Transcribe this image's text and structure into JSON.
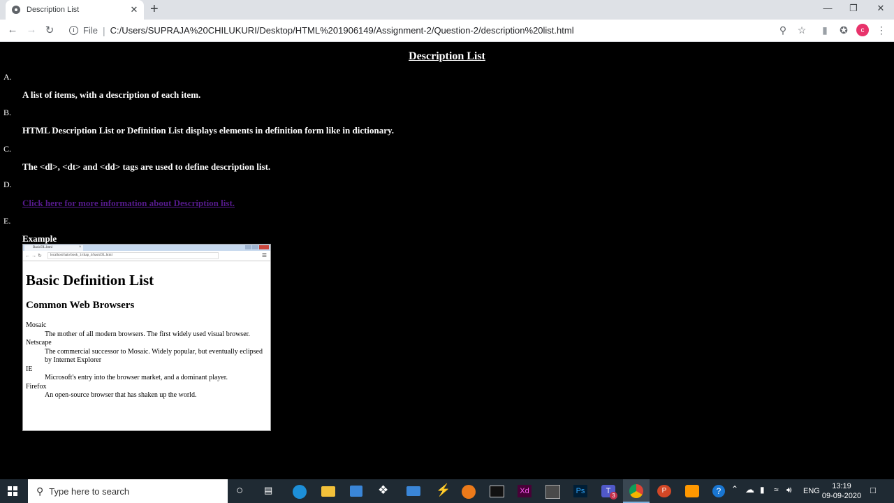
{
  "browser": {
    "tab_title": "Description List",
    "tab_close": "✕",
    "new_tab": "+",
    "scheme": "File",
    "separator": "|",
    "url": "C:/Users/SUPRAJA%20CHILUKURI/Desktop/HTML%201906149/Assignment-2/Question-2/description%20list.html",
    "profile_initial": "c",
    "icons": [
      "back-icon",
      "forward-icon",
      "reload-icon",
      "info-icon",
      "zoom-icon",
      "star-icon",
      "extension-icon",
      "puzzle-icon",
      "menu-icon"
    ]
  },
  "page": {
    "title": "Description List",
    "items": [
      {
        "term": "A.",
        "desc": "A list of items, with a description of each item."
      },
      {
        "term": "B.",
        "desc": "HTML Description List or Definition List displays elements in definition form like in dictionary."
      },
      {
        "term": "C.",
        "desc": "The <dl>, <dt> and <dd> tags are used to define description list."
      },
      {
        "term": "D.",
        "desc": "Click here for more information about Description list."
      },
      {
        "term": "E.",
        "desc": "Example"
      }
    ],
    "colors": {
      "background": "#000000",
      "text": "#ffffff",
      "link": "#551a8b"
    }
  },
  "example": {
    "tab_title": "BasicDL.html",
    "url": "localhost/haio/book_1/chap_4/basicDL.html",
    "heading1": "Basic Definition List",
    "heading2": "Common Web Browsers",
    "entries": [
      {
        "term": "Mosaic",
        "desc": "The mother of all modern browsers. The first widely used visual browser."
      },
      {
        "term": "Netscape",
        "desc": "The commercial successor to Mosaic. Widely popular, but eventually eclipsed by Internet Explorer"
      },
      {
        "term": "IE",
        "desc": "Microsoft's entry into the browser market, and a dominant player."
      },
      {
        "term": "Firefox",
        "desc": "An open-source browser that has shaken up the world."
      }
    ]
  },
  "taskbar": {
    "search_placeholder": "Type here to search",
    "language": "ENG",
    "time": "13:19",
    "date": "09-09-2020",
    "apps": [
      "cortana-icon",
      "task-view-icon",
      "edge-icon",
      "file-explorer-icon",
      "store-icon",
      "dropbox-icon",
      "mail-icon",
      "vscode-icon",
      "firefox-icon",
      "terminal-icon",
      "xd-icon",
      "app-icon",
      "photoshop-icon",
      "teams-icon",
      "chrome-icon",
      "powerpoint-icon",
      "sublime-icon"
    ],
    "labels": {
      "xd": "Xd",
      "ps": "Ps",
      "teams": "T",
      "teams_badge": "3",
      "ppt": "P",
      "help": "?"
    }
  }
}
